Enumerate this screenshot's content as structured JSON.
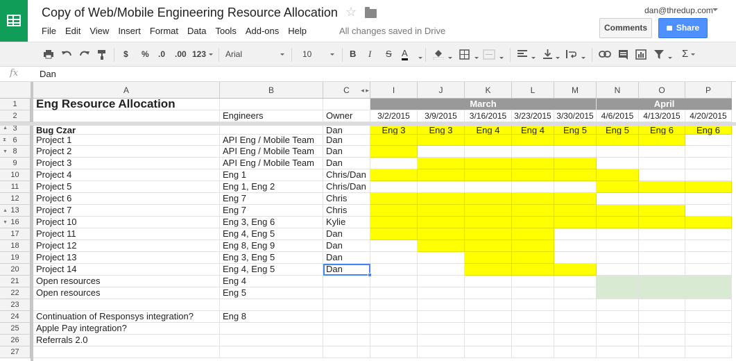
{
  "header": {
    "title": "Copy of Web/Mobile Engineering Resource Allocation",
    "save_status": "All changes saved in Drive",
    "user_email": "dan@thredup.com",
    "comments_label": "Comments",
    "share_label": "Share"
  },
  "menu": [
    "File",
    "Edit",
    "View",
    "Insert",
    "Format",
    "Data",
    "Tools",
    "Add-ons",
    "Help"
  ],
  "toolbar": {
    "currency": "$",
    "percent": "%",
    "dec_decrease": ".0",
    "dec_increase": ".00",
    "more_formats": "123",
    "font": "Arial",
    "font_size": "10",
    "bold": "B",
    "italic": "I",
    "strike": "S",
    "text_color": "A",
    "sum": "Σ"
  },
  "formula_bar": {
    "fx": "fx",
    "value": "Dan"
  },
  "columns": [
    "A",
    "B",
    "C",
    "I",
    "J",
    "K",
    "L",
    "M",
    "N",
    "O",
    "P"
  ],
  "rows": [
    "1",
    "2",
    "3",
    "6",
    "8",
    "9",
    "10",
    "11",
    "12",
    "13",
    "16",
    "17",
    "18",
    "19",
    "20",
    "21",
    "22",
    "23",
    "24",
    "25",
    "26",
    "27"
  ],
  "sheet": {
    "title": "Eng Resource Allocation",
    "engineers_header": "Engineers",
    "owner_header": "Owner",
    "months": [
      "March",
      "April"
    ],
    "dates": [
      "3/2/2015",
      "3/9/2015",
      "3/16/2015",
      "3/23/2015",
      "3/30/2015",
      "4/6/2015",
      "4/13/2015",
      "4/20/2015"
    ],
    "bug_czar": {
      "label": "Bug Czar",
      "owner": "Dan",
      "engs": [
        "Eng 3",
        "Eng 3",
        "Eng 4",
        "Eng 4",
        "Eng 5",
        "Eng 5",
        "Eng 6",
        "Eng 6"
      ]
    },
    "projects": [
      {
        "name": "Project 1",
        "eng": "API Eng / Mobile Team",
        "owner": "Dan"
      },
      {
        "name": "Project 2",
        "eng": "API Eng / Mobile Team",
        "owner": "Dan"
      },
      {
        "name": "Project 3",
        "eng": "API Eng / Mobile Team",
        "owner": "Dan"
      },
      {
        "name": "Project 4",
        "eng": "Eng 1",
        "owner": "Chris/Dan"
      },
      {
        "name": "Project 5",
        "eng": "Eng 1, Eng 2",
        "owner": "Chris/Dan"
      },
      {
        "name": "Project 6",
        "eng": "Eng 7",
        "owner": "Chris"
      },
      {
        "name": "Project 7",
        "eng": "Eng 7",
        "owner": "Chris"
      },
      {
        "name": "Project 10",
        "eng": "Eng 3, Eng 6",
        "owner": "Kylie"
      },
      {
        "name": "Project 11",
        "eng": "Eng 4, Eng 5",
        "owner": "Dan"
      },
      {
        "name": "Project 12",
        "eng": "Eng 8, Eng 9",
        "owner": "Dan"
      },
      {
        "name": "Project 13",
        "eng": "Eng 3, Eng 5",
        "owner": "Dan"
      },
      {
        "name": "Project 14",
        "eng": "Eng 4, Eng 5",
        "owner": "Dan"
      }
    ],
    "open_resources": [
      {
        "name": "Open resources",
        "eng": "Eng 4"
      },
      {
        "name": "Open resources",
        "eng": "Eng 5"
      }
    ],
    "misc": [
      {
        "name": "Continuation of Responsys integration?",
        "eng": "Eng 8"
      },
      {
        "name": "Apple Pay integration?",
        "eng": ""
      },
      {
        "name": "Referrals 2.0",
        "eng": ""
      }
    ]
  },
  "colors": {
    "highlight": "#ffff00",
    "open": "#d9ead3",
    "month_header": "#999999",
    "brand": "#0f9d58",
    "share": "#4d90fe"
  }
}
